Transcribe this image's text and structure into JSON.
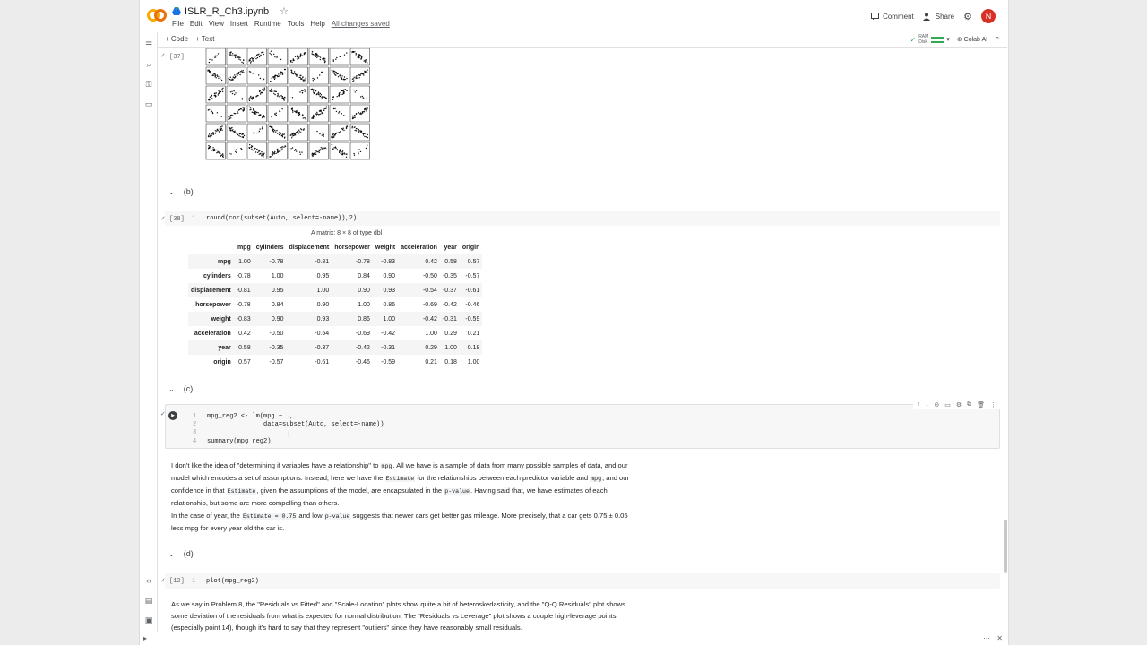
{
  "header": {
    "notebook_title": "ISLR_R_Ch3.ipynb",
    "menu": [
      "File",
      "Edit",
      "View",
      "Insert",
      "Runtime",
      "Tools",
      "Help"
    ],
    "saved_status": "All changes saved",
    "comment_label": "Comment",
    "share_label": "Share",
    "avatar_letter": "N"
  },
  "toolbar": {
    "add_code": "+ Code",
    "add_text": "+ Text",
    "ram_label": "RAM",
    "disk_label": "Disk",
    "colab_ai": "Colab AI"
  },
  "cells": {
    "c37": {
      "exec": "[37]"
    },
    "b_head": "(b)",
    "c38": {
      "exec": "[38]",
      "line": "1",
      "code": "round(cor(subset(Auto, select=-name)),2)"
    },
    "matrix": {
      "caption": "A matrix: 8 × 8 of type dbl",
      "columns": [
        "mpg",
        "cylinders",
        "displacement",
        "horsepower",
        "weight",
        "acceleration",
        "year",
        "origin"
      ],
      "rows": [
        {
          "name": "mpg",
          "values": [
            "1.00",
            "-0.78",
            "-0.81",
            "-0.78",
            "-0.83",
            "0.42",
            "0.58",
            "0.57"
          ]
        },
        {
          "name": "cylinders",
          "values": [
            "-0.78",
            "1.00",
            "0.95",
            "0.84",
            "0.90",
            "-0.50",
            "-0.35",
            "-0.57"
          ]
        },
        {
          "name": "displacement",
          "values": [
            "-0.81",
            "0.95",
            "1.00",
            "0.90",
            "0.93",
            "-0.54",
            "-0.37",
            "-0.61"
          ]
        },
        {
          "name": "horsepower",
          "values": [
            "-0.78",
            "0.84",
            "0.90",
            "1.00",
            "0.86",
            "-0.69",
            "-0.42",
            "-0.46"
          ]
        },
        {
          "name": "weight",
          "values": [
            "-0.83",
            "0.90",
            "0.93",
            "0.86",
            "1.00",
            "-0.42",
            "-0.31",
            "-0.59"
          ]
        },
        {
          "name": "acceleration",
          "values": [
            "0.42",
            "-0.50",
            "-0.54",
            "-0.69",
            "-0.42",
            "1.00",
            "0.29",
            "0.21"
          ]
        },
        {
          "name": "year",
          "values": [
            "0.58",
            "-0.35",
            "-0.37",
            "-0.42",
            "-0.31",
            "0.29",
            "1.00",
            "0.18"
          ]
        },
        {
          "name": "origin",
          "values": [
            "0.57",
            "-0.57",
            "-0.61",
            "-0.46",
            "-0.59",
            "0.21",
            "0.18",
            "1.00"
          ]
        }
      ]
    },
    "c_head": "(c)",
    "c_code": {
      "lines": [
        "1",
        "2",
        "3",
        "4"
      ],
      "code": [
        "mpg_reg2 <- lm(mpg ~ .,",
        "               data=subset(Auto, select=-name))",
        "",
        "summary(mpg_reg2)"
      ]
    },
    "para1": {
      "t1": "I don't like the idea of \"determining if variables have a relationship\" to ",
      "c1": "mpg",
      "t2": ". All we have is a sample of data from many possible samples of data, and our model which encodes a set of assumptions. Instead, here we have the ",
      "c2": "Estimate",
      "t3": " for the relationships between each predictor variable and ",
      "c3": "mpg",
      "t4": ", and our confidence in that ",
      "c4": "Estimate",
      "t5": ", given the assumptions of the model, are encapsulated in the ",
      "c5": "p-value",
      "t6": ". Having said that, we have estimates of each relationship, but some are more compelling than others."
    },
    "para2": {
      "t1": "In the case of year, the ",
      "c1": "Estimate = 0.75",
      "t2": " and low ",
      "c2": "p-value",
      "t3": " suggests that newer cars get better gas mileage. More precisely, that a car gets 0.75 ± 0.05 less mpg for every year old the car is."
    },
    "d_head": "(d)",
    "c12": {
      "exec": "[12]",
      "line": "1",
      "code": "plot(mpg_reg2)"
    },
    "para3": "As we say in Problem 8, the \"Residuals vs Fitted\" and \"Scale-Location\" plots show quite a bit of heteroskedasticity, and the \"Q-Q Residuals\" plot shows some deviation of the residuals from what is expected for normal distribution. The \"Residuals vs Leverage\" plot shows a couple high-leverage points (especially point 14), though it's hard to say that they represent \"outliers\" since they have reasonably small residuals."
  },
  "icons": {
    "star": "star-icon",
    "comment": "comment-icon",
    "share": "share-icon",
    "settings": "gear-icon"
  }
}
